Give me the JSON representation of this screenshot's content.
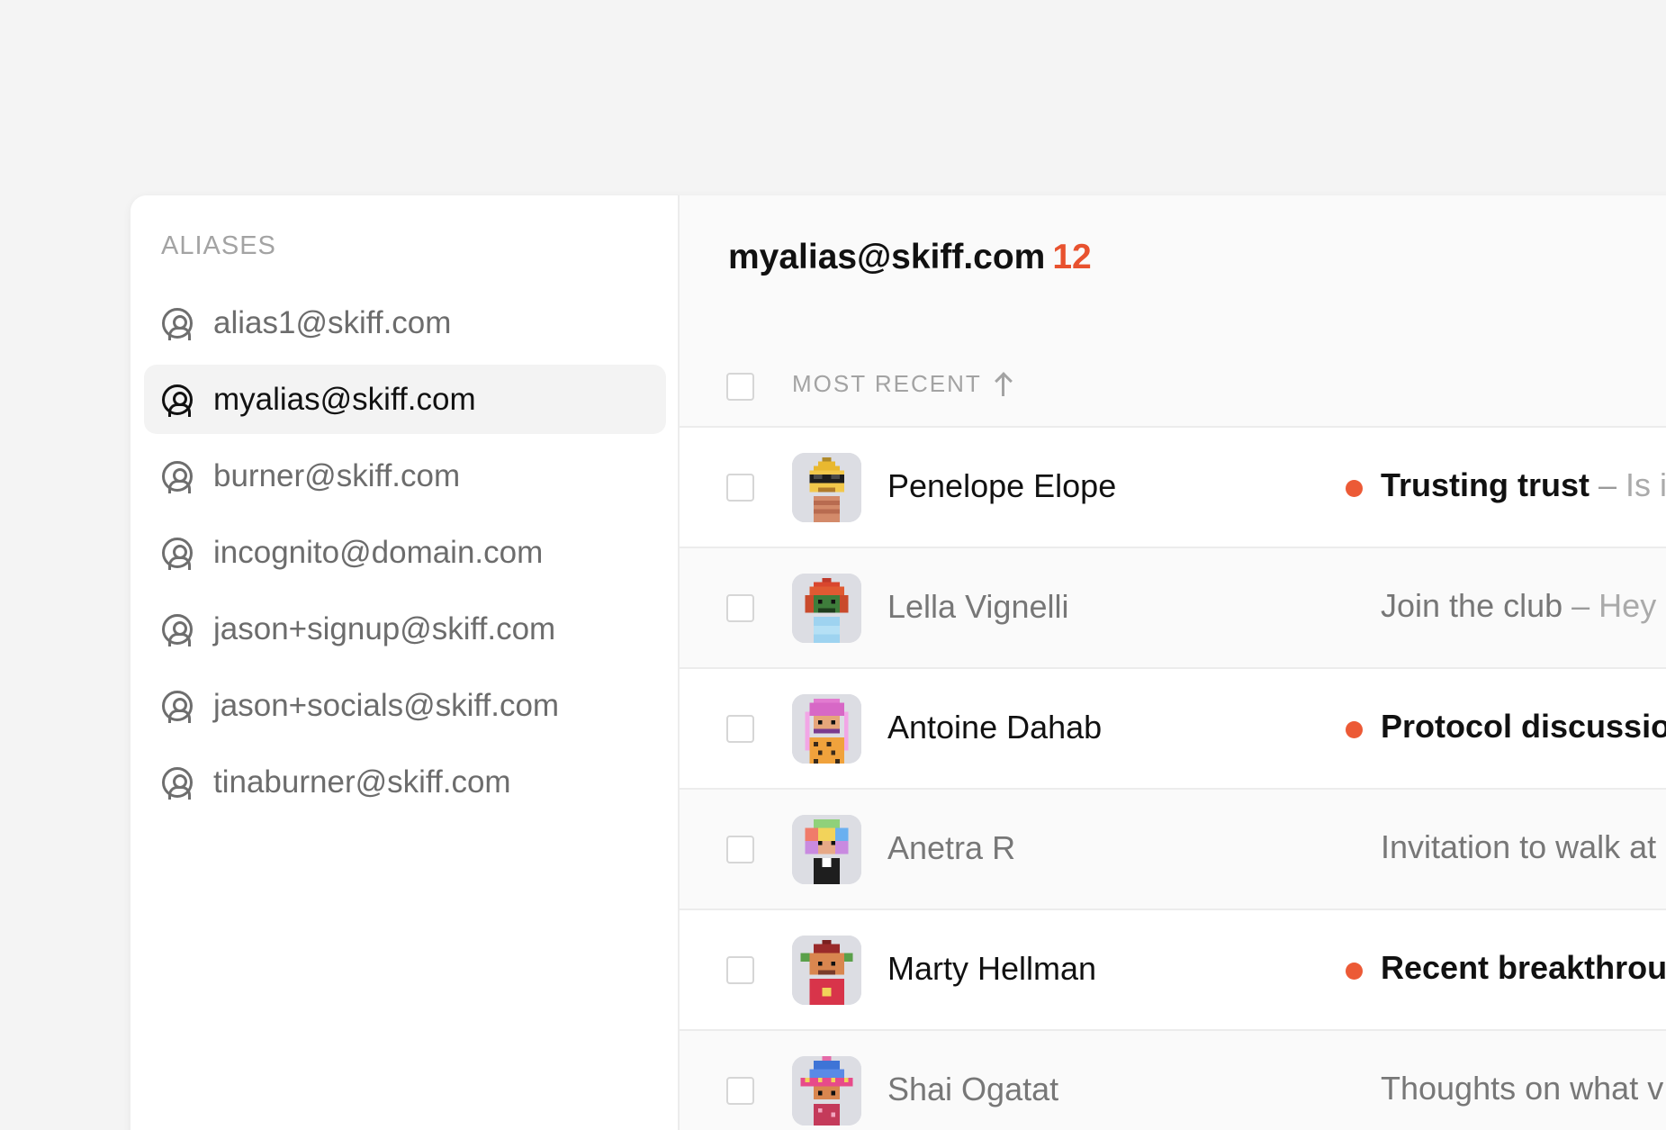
{
  "sidebar": {
    "heading": "ALIASES",
    "items": [
      {
        "label": "alias1@skiff.com",
        "active": false
      },
      {
        "label": "myalias@skiff.com",
        "active": true
      },
      {
        "label": "burner@skiff.com",
        "active": false
      },
      {
        "label": "incognito@domain.com",
        "active": false
      },
      {
        "label": "jason+signup@skiff.com",
        "active": false
      },
      {
        "label": "jason+socials@skiff.com",
        "active": false
      },
      {
        "label": "tinaburner@skiff.com",
        "active": false
      }
    ]
  },
  "main": {
    "title": "myalias@skiff.com",
    "count": "12",
    "sort_label": "MOST RECENT",
    "accent_color": "#ec5a36"
  },
  "messages": [
    {
      "sender": "Penelope Elope",
      "subject": "Trusting trust",
      "separator": "–",
      "preview": "Is i",
      "unread": true
    },
    {
      "sender": "Lella Vignelli",
      "subject": "Join the club",
      "separator": "–",
      "preview": "Hey",
      "unread": false
    },
    {
      "sender": "Antoine Dahab",
      "subject": "Protocol discussio",
      "separator": "",
      "preview": "",
      "unread": true
    },
    {
      "sender": "Anetra R",
      "subject": "Invitation to walk at",
      "separator": "",
      "preview": "",
      "unread": false
    },
    {
      "sender": "Marty Hellman",
      "subject": "Recent breakthrou",
      "separator": "",
      "preview": "",
      "unread": true
    },
    {
      "sender": "Shai Ogatat",
      "subject": "Thoughts on what v",
      "separator": "",
      "preview": "",
      "unread": false
    }
  ]
}
